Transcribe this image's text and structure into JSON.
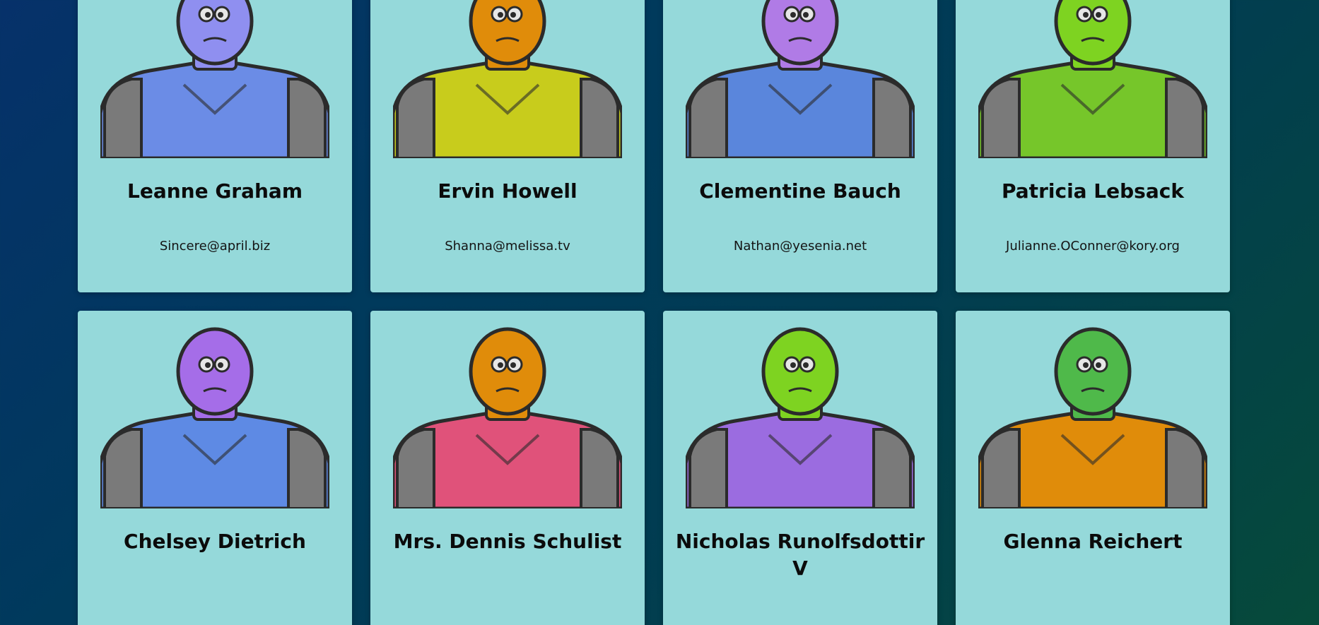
{
  "users": [
    {
      "name": "Leanne Graham",
      "email": "Sincere@april.biz",
      "avatar": "robot-avatar-icon",
      "head": "#8f8ff0",
      "body": "#6b8ce6"
    },
    {
      "name": "Ervin Howell",
      "email": "Shanna@melissa.tv",
      "avatar": "robot-avatar-icon",
      "head": "#e08c0a",
      "body": "#c8cc1c"
    },
    {
      "name": "Clementine Bauch",
      "email": "Nathan@yesenia.net",
      "avatar": "robot-avatar-icon",
      "head": "#b07be6",
      "body": "#5a86dc"
    },
    {
      "name": "Patricia Lebsack",
      "email": "Julianne.OConner@kory.org",
      "avatar": "robot-avatar-icon",
      "head": "#7ed321",
      "body": "#76c62a"
    },
    {
      "name": "Chelsey Dietrich",
      "email": "",
      "avatar": "robot-avatar-icon",
      "head": "#a56de8",
      "body": "#5e8ae4"
    },
    {
      "name": "Mrs. Dennis Schulist",
      "email": "",
      "avatar": "robot-avatar-icon",
      "head": "#e08c0a",
      "body": "#e0527a"
    },
    {
      "name": "Nicholas Runolfsdottir V",
      "email": "",
      "avatar": "robot-avatar-icon",
      "head": "#7ed321",
      "body": "#9b6ce0"
    },
    {
      "name": "Glenna Reichert",
      "email": "",
      "avatar": "robot-avatar-icon",
      "head": "#4fb94a",
      "body": "#e08c0a"
    }
  ]
}
